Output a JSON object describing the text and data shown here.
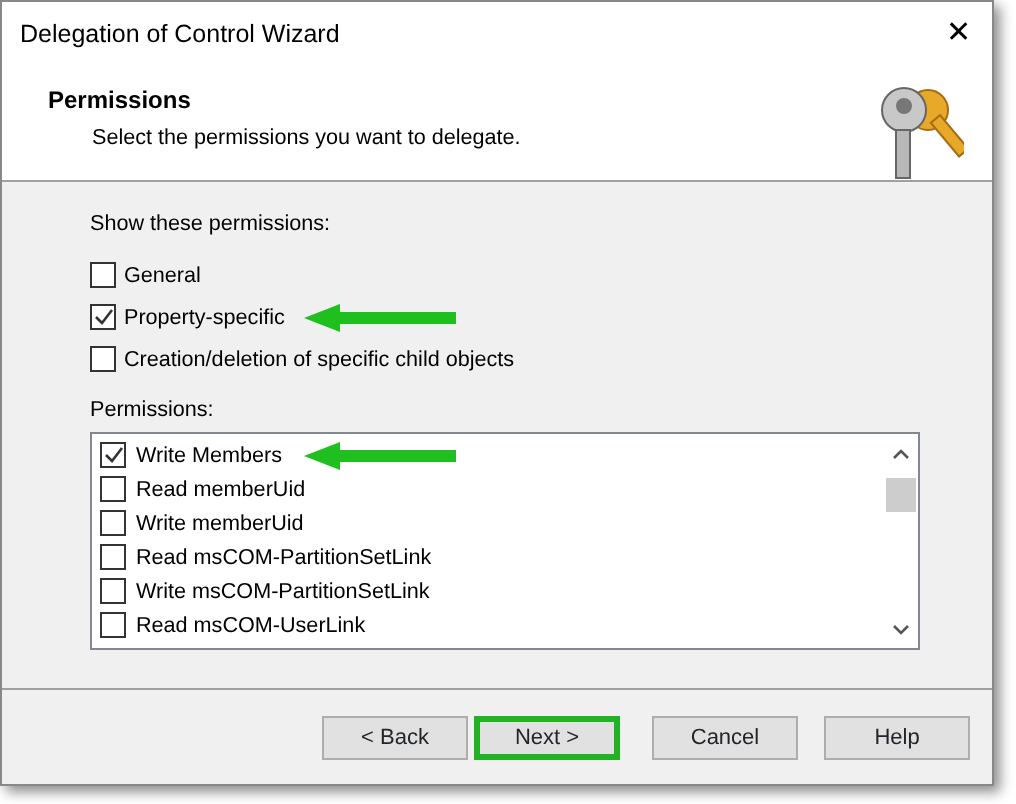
{
  "window": {
    "title": "Delegation of Control Wizard",
    "close": "✕"
  },
  "header": {
    "title": "Permissions",
    "subtitle": "Select the permissions you want to delegate."
  },
  "show_label": "Show these permissions:",
  "show_options": [
    {
      "label": "General",
      "checked": false,
      "arrow": false
    },
    {
      "label": "Property-specific",
      "checked": true,
      "arrow": true
    },
    {
      "label": "Creation/deletion of specific child objects",
      "checked": false,
      "arrow": false
    }
  ],
  "permissions_label": "Permissions:",
  "permissions": [
    {
      "label": "Write Members",
      "checked": true,
      "arrow": true
    },
    {
      "label": "Read memberUid",
      "checked": false,
      "arrow": false
    },
    {
      "label": "Write memberUid",
      "checked": false,
      "arrow": false
    },
    {
      "label": "Read msCOM-PartitionSetLink",
      "checked": false,
      "arrow": false
    },
    {
      "label": "Write msCOM-PartitionSetLink",
      "checked": false,
      "arrow": false
    },
    {
      "label": "Read msCOM-UserLink",
      "checked": false,
      "arrow": false
    }
  ],
  "buttons": [
    {
      "label": "< Back",
      "highlighted": false
    },
    {
      "label": "Next >",
      "highlighted": true
    },
    {
      "label": "Cancel",
      "highlighted": false
    },
    {
      "label": "Help",
      "highlighted": false
    }
  ]
}
